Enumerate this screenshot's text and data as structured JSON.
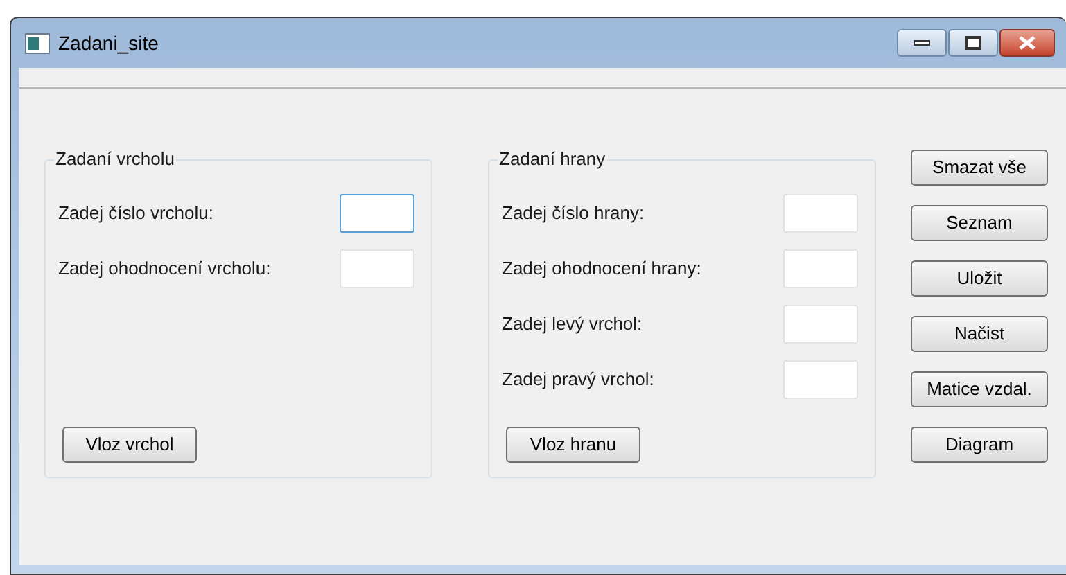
{
  "window": {
    "title": "Zadani_site"
  },
  "groups": [
    {
      "title": "Zadaní vrcholu",
      "fields": [
        {
          "label": "Zadej číslo vrcholu:",
          "focused": true
        },
        {
          "label": "Zadej ohodnocení vrcholu:",
          "focused": false
        }
      ],
      "button": "Vloz vrchol"
    },
    {
      "title": "Zadaní hrany",
      "fields": [
        {
          "label": "Zadej číslo hrany:",
          "focused": false
        },
        {
          "label": "Zadej ohodnocení hrany:",
          "focused": false
        },
        {
          "label": "Zadej levý vrchol:",
          "focused": false
        },
        {
          "label": "Zadej pravý vrchol:",
          "focused": false
        }
      ],
      "button": "Vloz hranu"
    }
  ],
  "buttons": [
    "Smazat vše",
    "Seznam",
    "Uložit",
    "Načist",
    "Matice vzdal.",
    "Diagram"
  ]
}
